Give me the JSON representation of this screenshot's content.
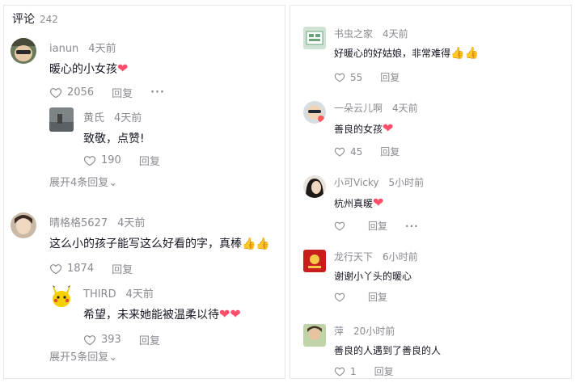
{
  "left": {
    "title": "评论",
    "count": "242",
    "comments": [
      {
        "user": "ianun",
        "time": "4天前",
        "text": "暖心的小女孩",
        "emoji": "❤",
        "likes": "2056",
        "reply_label": "回复",
        "more": "···"
      },
      {
        "user": "黄氏",
        "time": "4天前",
        "text": "致敬，点赞!",
        "likes": "190",
        "reply_label": "回复"
      },
      {
        "expand": "展开4条回复⌄"
      },
      {
        "user": "晴格格5627",
        "time": "4天前",
        "text": "这么小的孩子能写这么好看的字，真棒",
        "emoji": "👍👍",
        "likes": "1874",
        "reply_label": "回复"
      },
      {
        "user": "THIRD",
        "time": "4天前",
        "text": "希望，未来她能被温柔以待",
        "emoji": "❤❤",
        "likes": "393",
        "reply_label": "回复"
      },
      {
        "expand": "展开5条回复⌄"
      }
    ]
  },
  "right": {
    "comments": [
      {
        "user": "书虫之家",
        "time": "4天前",
        "text": "好暖心的好姑娘，非常难得",
        "emoji": "👍👍",
        "likes": "55",
        "reply_label": "回复"
      },
      {
        "user": "一朵云儿啊",
        "time": "4天前",
        "text": "善良的女孩",
        "emoji": "❤",
        "likes": "45",
        "reply_label": "回复"
      },
      {
        "user": "小可Vicky",
        "time": "5小时前",
        "text": "杭州真暖",
        "emoji": "❤",
        "likes": "",
        "reply_label": "回复",
        "more": "···"
      },
      {
        "user": "龙行天下",
        "time": "6小时前",
        "text": "谢谢小丫头的暖心",
        "likes": "",
        "reply_label": "回复"
      },
      {
        "user": "萍",
        "time": "20小时前",
        "text": "善良的人遇到了善良的人",
        "likes": "1",
        "reply_label": "回复"
      }
    ]
  },
  "colors": {
    "primary_text": "#161823",
    "secondary_text": "#8a8b91",
    "heart": "#ff4d6a",
    "border": "#e6e6e6"
  }
}
